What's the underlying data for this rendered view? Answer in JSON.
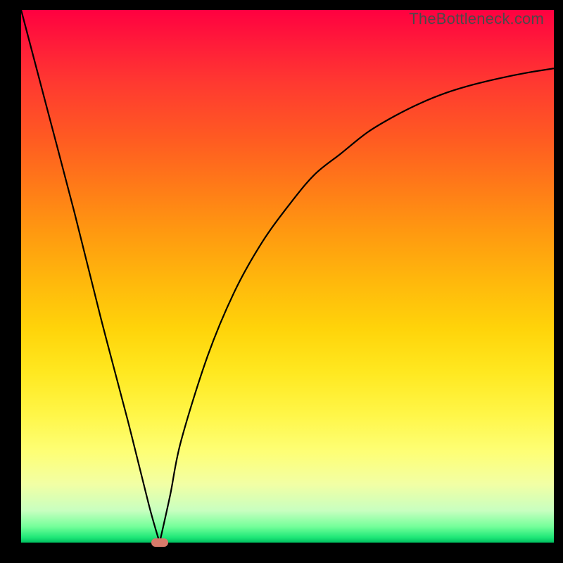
{
  "watermark": "TheBottleneck.com",
  "colors": {
    "frame": "#000000",
    "curve": "#000000",
    "marker": "#d87a6a",
    "gradient_top": "#ff0040",
    "gradient_bottom": "#00c060"
  },
  "chart_data": {
    "type": "line",
    "title": "",
    "xlabel": "",
    "ylabel": "",
    "xlim": [
      0,
      100
    ],
    "ylim": [
      0,
      100
    ],
    "annotations": [
      {
        "type": "marker",
        "x": 26,
        "y": 0
      }
    ],
    "series": [
      {
        "name": "bottleneck-curve",
        "x": [
          0,
          5,
          10,
          15,
          20,
          24,
          26,
          28,
          30,
          35,
          40,
          45,
          50,
          55,
          60,
          65,
          70,
          75,
          80,
          85,
          90,
          95,
          100
        ],
        "values": [
          100,
          81,
          62,
          42,
          23,
          7,
          0,
          9,
          19,
          35,
          47,
          56,
          63,
          69,
          73,
          77,
          80,
          82.5,
          84.5,
          86,
          87.2,
          88.2,
          89
        ]
      }
    ]
  }
}
